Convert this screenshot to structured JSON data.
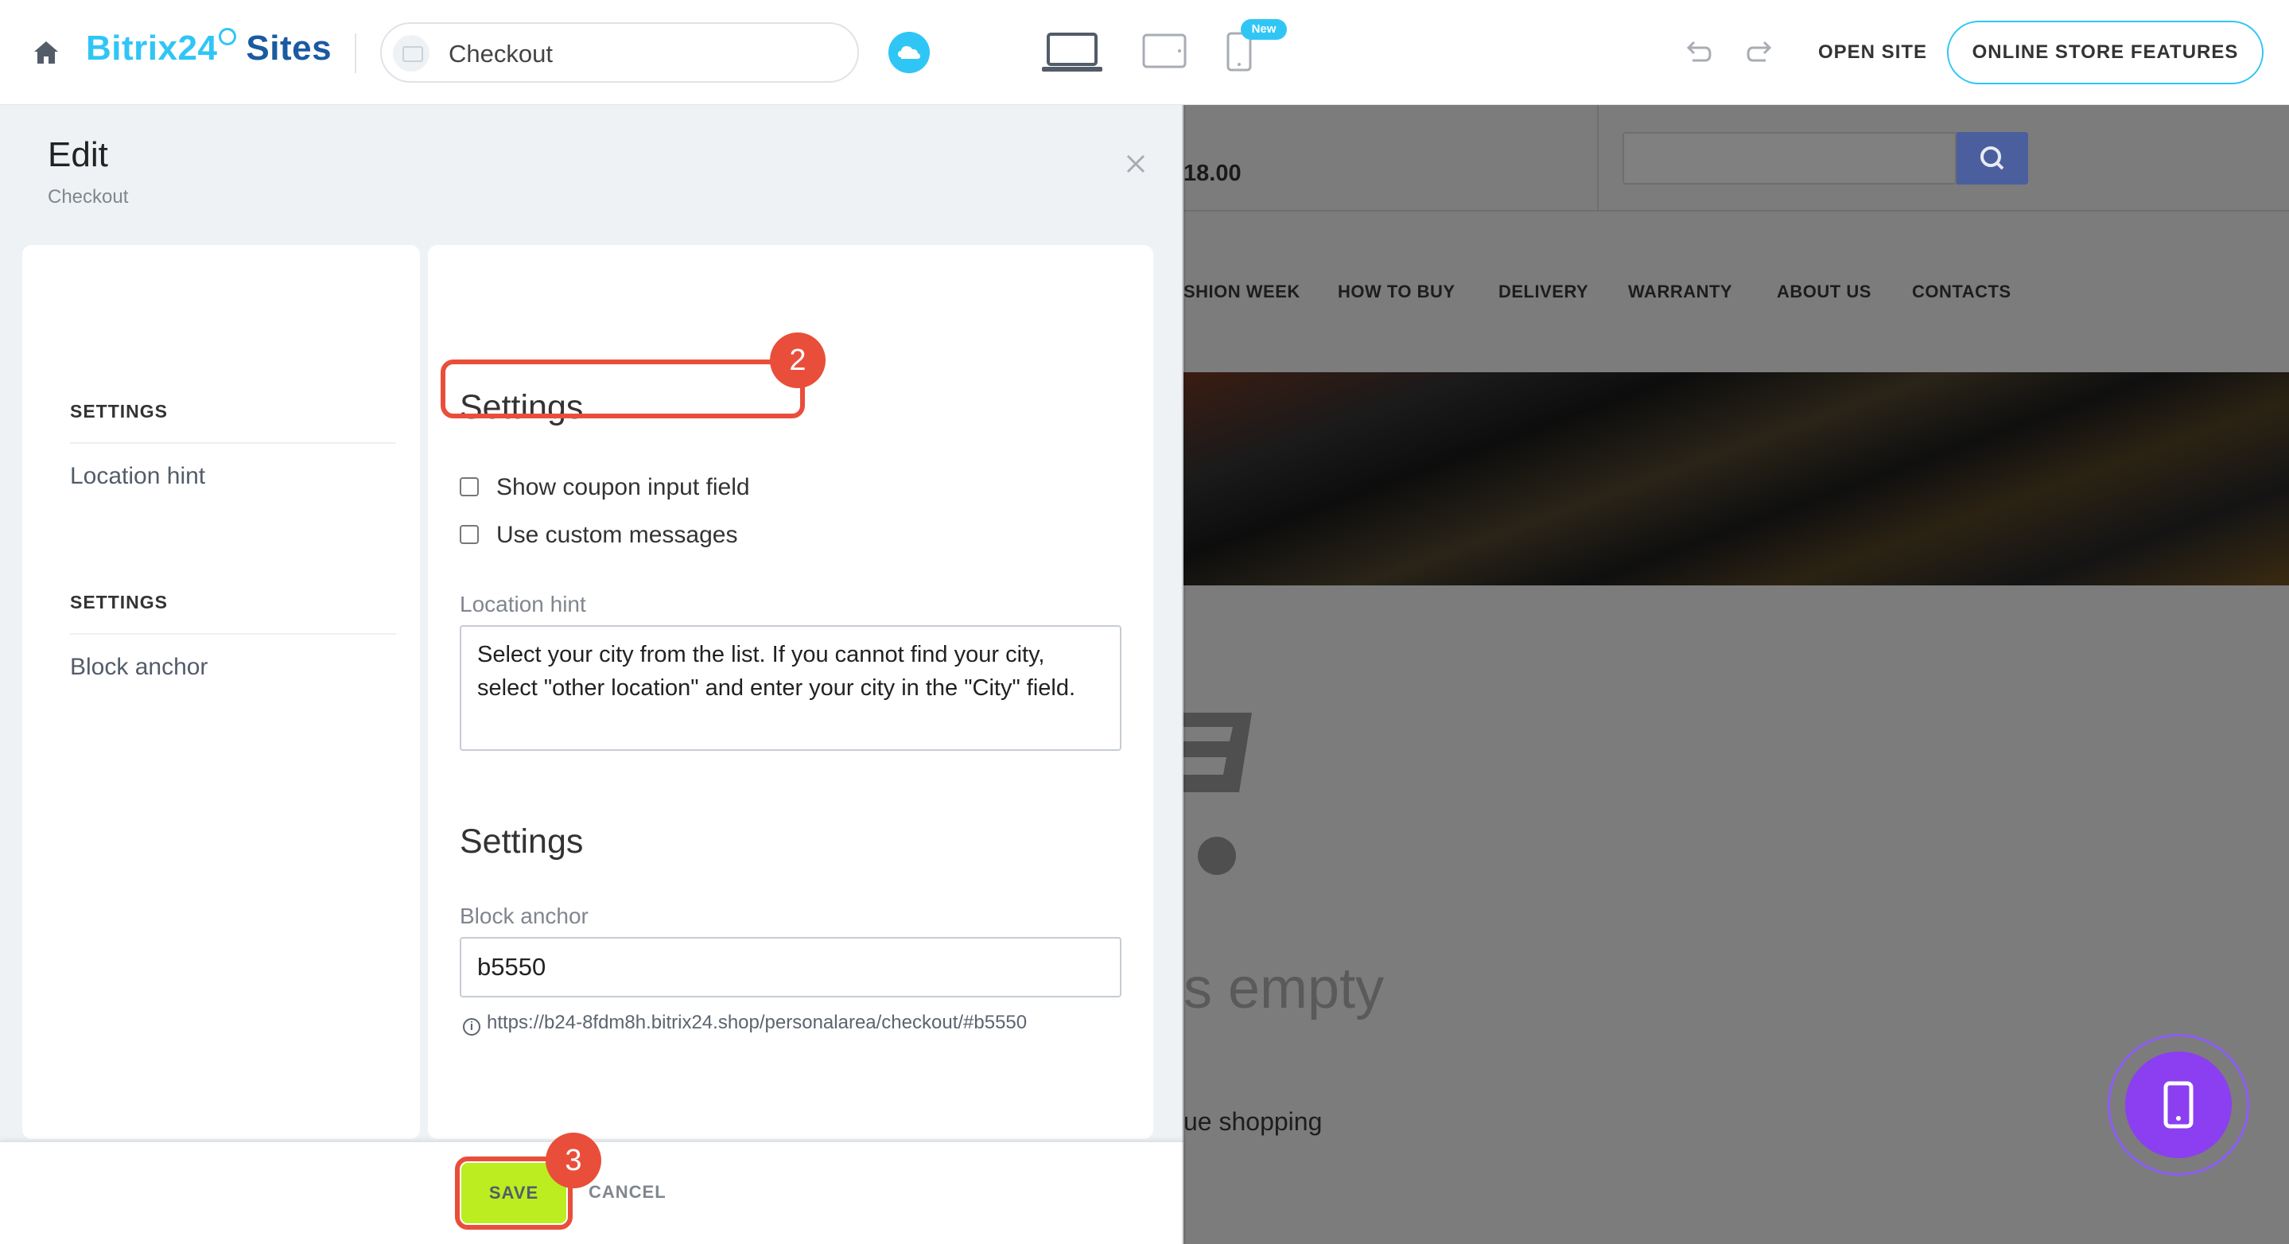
{
  "topbar": {
    "brand_name": "Bitrix24",
    "brand_suffix": "Sites",
    "page_name": "Checkout",
    "new_badge": "New",
    "open_site": "OPEN SITE",
    "features_button": "ONLINE STORE FEATURES",
    "icons": [
      "home-icon",
      "cloud-icon",
      "desktop-icon",
      "tablet-icon",
      "mobile-icon",
      "undo-icon",
      "redo-icon"
    ]
  },
  "panel": {
    "title": "Edit",
    "subtitle": "Checkout",
    "nav": [
      {
        "heading": "SETTINGS",
        "item": "Location hint"
      },
      {
        "heading": "SETTINGS",
        "item": "Block anchor"
      }
    ],
    "section1": {
      "title": "Settings",
      "checkbox_coupon": "Show coupon input field",
      "checkbox_messages": "Use custom messages",
      "location_hint_label": "Location hint",
      "location_hint_value": "Select your city from the list. If you cannot find your city, select \"other location\" and enter your city in the \"City\" field."
    },
    "section2": {
      "title": "Settings",
      "anchor_label": "Block anchor",
      "anchor_value": "b5550",
      "anchor_url": "https://b24-8fdm8h.bitrix24.shop/personalarea/checkout/#b5550"
    },
    "save": "SAVE",
    "cancel": "CANCEL"
  },
  "callouts": {
    "coupon_step": "2",
    "save_step": "3"
  },
  "preview": {
    "price": "18.00",
    "nav": [
      "SHION WEEK",
      "HOW TO BUY",
      "DELIVERY",
      "WARRANTY",
      "ABOUT US",
      "CONTACTS"
    ],
    "empty_text": "s empty",
    "continue_text": "ue shopping"
  },
  "colors": {
    "accent": "#2fc6f6",
    "brand_dark": "#1b5aa1",
    "highlight": "#e94e3b",
    "save_green": "#bbed21",
    "preview_overlay": "#7c7c7c",
    "phone_button": "#8b3ff0"
  }
}
